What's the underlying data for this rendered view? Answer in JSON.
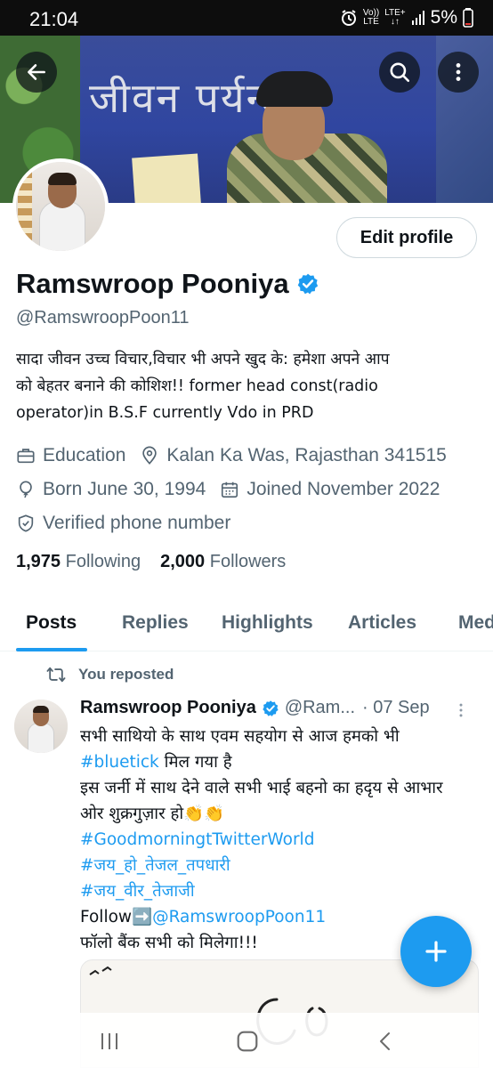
{
  "status_bar": {
    "time": "21:04",
    "net_top": "Vo))",
    "net_bottom": "LTE",
    "lte_top": "LTE+",
    "lte_bottom": "↓↑",
    "battery": "5%"
  },
  "profile": {
    "name": "Ramswroop Pooniya",
    "handle": "@RamswroopPoon11",
    "bio_lines": [
      "सादा जीवन उच्च विचार,विचार भी अपने खुद के: हमेशा अपने आप",
      "को बेहतर बनाने की कोशिश!! former head const(radio",
      "operator)in B.S.F currently Vdo in PRD"
    ],
    "category": "Education",
    "location": "Kalan Ka Was, Rajasthan 341515",
    "born": "Born June 30, 1994",
    "joined": "Joined November 2022",
    "verified_phone": "Verified phone number",
    "following_count": "1,975",
    "following_label": "Following",
    "followers_count": "2,000",
    "followers_label": "Followers",
    "edit_profile_label": "Edit profile",
    "banner_text": "जीवन पर्यन्त"
  },
  "tabs": [
    "Posts",
    "Replies",
    "Highlights",
    "Articles",
    "Med"
  ],
  "active_tab": 0,
  "post": {
    "repost_label": "You reposted",
    "author_name": "Ramswroop Pooniya",
    "author_handle": "@Ram...",
    "date": "· 07 Sep",
    "line1": "सभी साथियो के साथ एवम सहयोग से आज हमको भी",
    "line2_tag": "#bluetick",
    "line2_rest": " मिल गया है",
    "line3": "इस जर्नी में साथ देने वाले सभी भाई बहनो का हदृय से आभार",
    "line4": "ओर शुक्रगुज़ार  हो👏👏",
    "hashtag1": "#GoodmorningtTwitterWorld",
    "hashtag2": "#जय_हो_तेजल_तपधारी",
    "hashtag3": "#जय_वीर_तेजाजी",
    "follow_prefix": " Follow➡️",
    "follow_handle": "@RamswroopPoon11",
    "last_line": "फॉलो बैंक सभी को मिलेगा!!!"
  },
  "colors": {
    "accent": "#1d9bf0",
    "text_primary": "#0f1419",
    "text_secondary": "#536471"
  },
  "icons": {
    "back": "arrow-left-icon",
    "search": "search-icon",
    "more": "more-vertical-icon",
    "verified": "verified-badge-icon",
    "category": "briefcase-icon",
    "location": "location-pin-icon",
    "birthday": "balloon-icon",
    "calendar": "calendar-icon",
    "shield": "shield-check-icon",
    "repost": "repost-icon",
    "compose": "plus-icon"
  }
}
